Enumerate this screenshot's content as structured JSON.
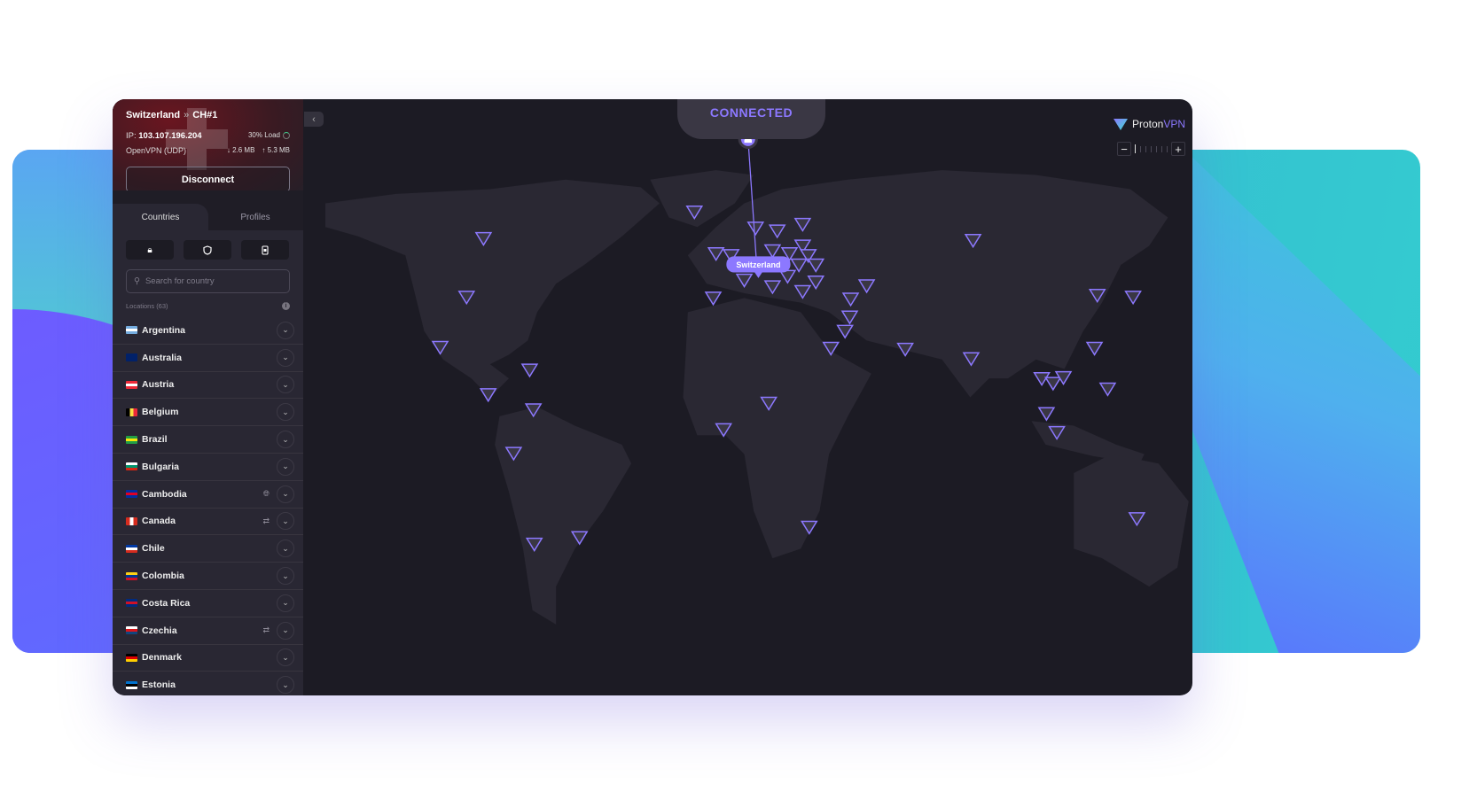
{
  "connection": {
    "country": "Switzerland",
    "server": "CH#1",
    "ip_label": "IP:",
    "ip": "103.107.196.204",
    "load": "30% Load",
    "protocol": "OpenVPN (UDP)",
    "download": "2.6 MB",
    "upload": "5.3 MB",
    "disconnect_label": "Disconnect",
    "status": "CONNECTED",
    "map_label": "Switzerland"
  },
  "tabs": [
    {
      "label": "Countries",
      "active": true
    },
    {
      "label": "Profiles",
      "active": false
    }
  ],
  "filters": [
    "lock-icon",
    "shield-icon",
    "sim-card-icon"
  ],
  "search": {
    "placeholder": "Search for country",
    "value": ""
  },
  "locations_label": "Locations (63)",
  "countries": [
    {
      "name": "Argentina",
      "flag": [
        "#74acdf",
        "#ffffff",
        "#74acdf"
      ]
    },
    {
      "name": "Australia",
      "flag": [
        "#012169",
        "#012169",
        "#012169"
      ]
    },
    {
      "name": "Austria",
      "flag": [
        "#ed2939",
        "#ffffff",
        "#ed2939"
      ]
    },
    {
      "name": "Belgium",
      "flag": [
        "#000000",
        "#fae042",
        "#ed2939"
      ],
      "vertical": true
    },
    {
      "name": "Brazil",
      "flag": [
        "#229e45",
        "#f8e509",
        "#229e45"
      ]
    },
    {
      "name": "Bulgaria",
      "flag": [
        "#ffffff",
        "#00966e",
        "#d62612"
      ]
    },
    {
      "name": "Cambodia",
      "flag": [
        "#032ea1",
        "#e00025",
        "#032ea1"
      ],
      "feature": "globe-icon"
    },
    {
      "name": "Canada",
      "flag": [
        "#d52b1e",
        "#ffffff",
        "#d52b1e"
      ],
      "vertical": true,
      "feature": "p2p-icon"
    },
    {
      "name": "Chile",
      "flag": [
        "#0039a6",
        "#ffffff",
        "#d52b1e"
      ]
    },
    {
      "name": "Colombia",
      "flag": [
        "#fcd116",
        "#003893",
        "#ce1126"
      ]
    },
    {
      "name": "Costa Rica",
      "flag": [
        "#002b7f",
        "#ce1126",
        "#002b7f"
      ]
    },
    {
      "name": "Czechia",
      "flag": [
        "#ffffff",
        "#d7141a",
        "#11457e"
      ],
      "feature": "p2p-icon"
    },
    {
      "name": "Denmark",
      "flag": [
        "#000000",
        "#dd0000",
        "#ffce00"
      ]
    },
    {
      "name": "Estonia",
      "flag": [
        "#0072ce",
        "#000000",
        "#ffffff"
      ]
    }
  ],
  "brand": {
    "name_a": "Proton",
    "name_b": "VPN",
    "accent": "#8c78ff"
  },
  "colors": {
    "window": "#1c1b24",
    "sidebar": "#292733",
    "land": "#2a2833",
    "marker": "#8c78ff"
  }
}
